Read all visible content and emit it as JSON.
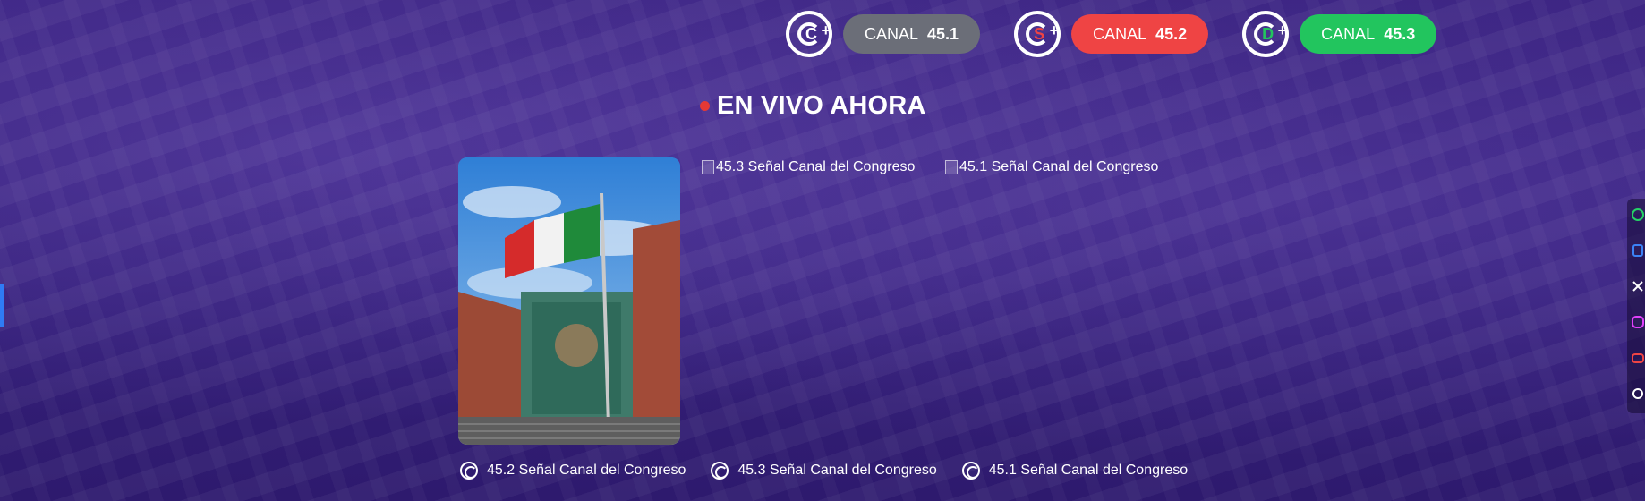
{
  "channels": [
    {
      "logo_letter": "C",
      "label": "CANAL",
      "number": "45.1",
      "color": "#6b6e78"
    },
    {
      "logo_letter": "S",
      "label": "CANAL",
      "number": "45.2",
      "color": "#ef4444"
    },
    {
      "logo_letter": "D",
      "label": "CANAL",
      "number": "45.3",
      "color": "#22c55e"
    }
  ],
  "live": {
    "title": "EN VIVO AHORA",
    "dot_color": "#e53935"
  },
  "broken_images": [
    {
      "alt": "45.3 Señal Canal del Congreso"
    },
    {
      "alt": "45.1 Señal Canal del Congreso"
    }
  ],
  "bottom_links": [
    {
      "label": "45.2 Señal Canal del Congreso"
    },
    {
      "label": "45.3 Señal Canal del Congreso"
    },
    {
      "label": "45.1 Señal Canal del Congreso"
    }
  ],
  "social_icons": [
    "whatsapp-icon",
    "facebook-icon",
    "x-icon",
    "instagram-icon",
    "youtube-icon",
    "threads-icon"
  ],
  "colors": {
    "background": "#35207a",
    "left_marker": "#2f7bf5"
  }
}
